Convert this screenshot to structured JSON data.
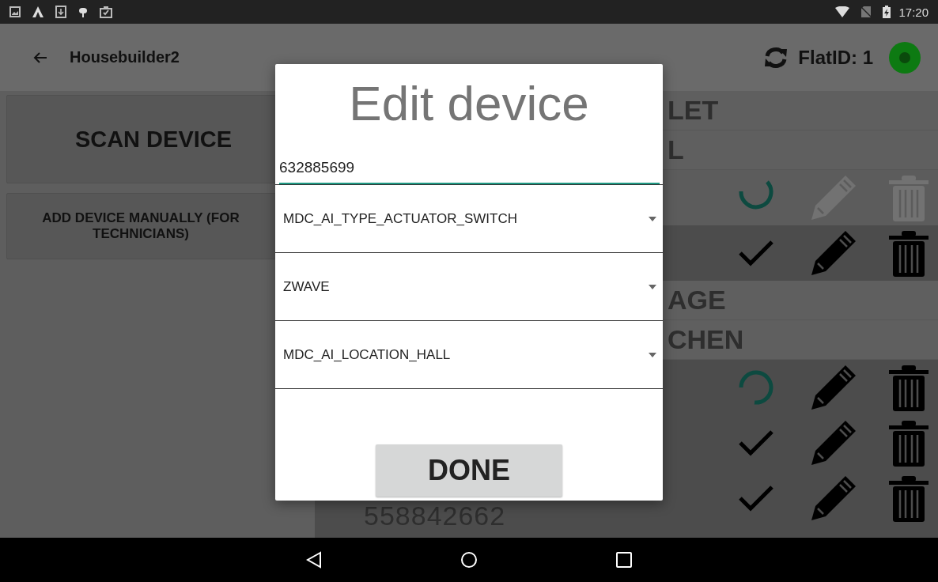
{
  "status_bar": {
    "time": "17:20"
  },
  "app_bar": {
    "title": "Housebuilder2",
    "flat_id": "FlatID: 1",
    "connected": true
  },
  "left_panel": {
    "buttons": [
      "SCAN DEVICE",
      "ADD DEVICE MANUALLY (FOR TECHNICIANS)"
    ]
  },
  "device_list": [
    {
      "kind": "header",
      "label": "LET"
    },
    {
      "kind": "header",
      "label": "L"
    },
    {
      "kind": "device",
      "loading": true,
      "disabled": true
    },
    {
      "kind": "device",
      "loading": false,
      "disabled": false
    },
    {
      "kind": "header",
      "label": "AGE"
    },
    {
      "kind": "header",
      "label": "CHEN"
    },
    {
      "kind": "device",
      "loading": true,
      "disabled": false
    },
    {
      "kind": "device",
      "loading": false,
      "disabled": false
    },
    {
      "kind": "device",
      "loading": false,
      "disabled": false,
      "number": "558842662"
    }
  ],
  "dialog": {
    "title": "Edit device",
    "device_id": "632885699",
    "dropdowns": [
      "MDC_AI_TYPE_ACTUATOR_SWITCH",
      "ZWAVE",
      "MDC_AI_LOCATION_HALL"
    ],
    "button": "DONE"
  }
}
